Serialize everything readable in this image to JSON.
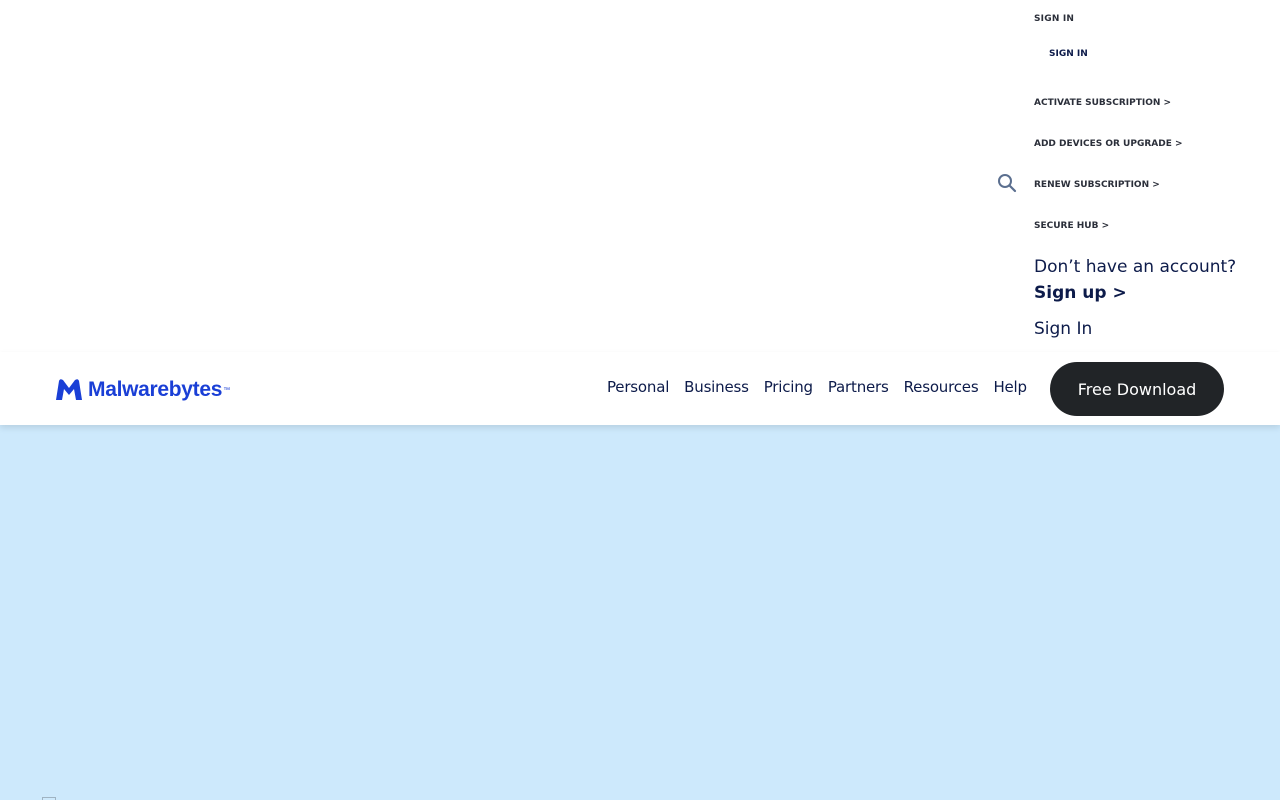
{
  "signin_panel": {
    "heading": "SIGN IN",
    "signin_link": "SIGN IN",
    "links": [
      "ACTIVATE SUBSCRIPTION >",
      "ADD DEVICES OR UPGRADE >",
      "RENEW SUBSCRIPTION >",
      "SECURE HUB >"
    ],
    "no_account_text": "Don’t have an account?",
    "signup_link": "Sign up >",
    "signin_plain": "Sign In"
  },
  "search": {
    "icon": "search-icon"
  },
  "header": {
    "logo_text": "Malwarebytes",
    "logo_tm": "™",
    "nav": [
      "Personal",
      "Business",
      "Pricing",
      "Partners",
      "Resources",
      "Help"
    ],
    "download_label": "Free Download"
  },
  "colors": {
    "brand_blue": "#1a3fd6",
    "navy_text": "#0d1b4a",
    "hero_bg": "#cde9fc",
    "button_dark": "#212427"
  }
}
